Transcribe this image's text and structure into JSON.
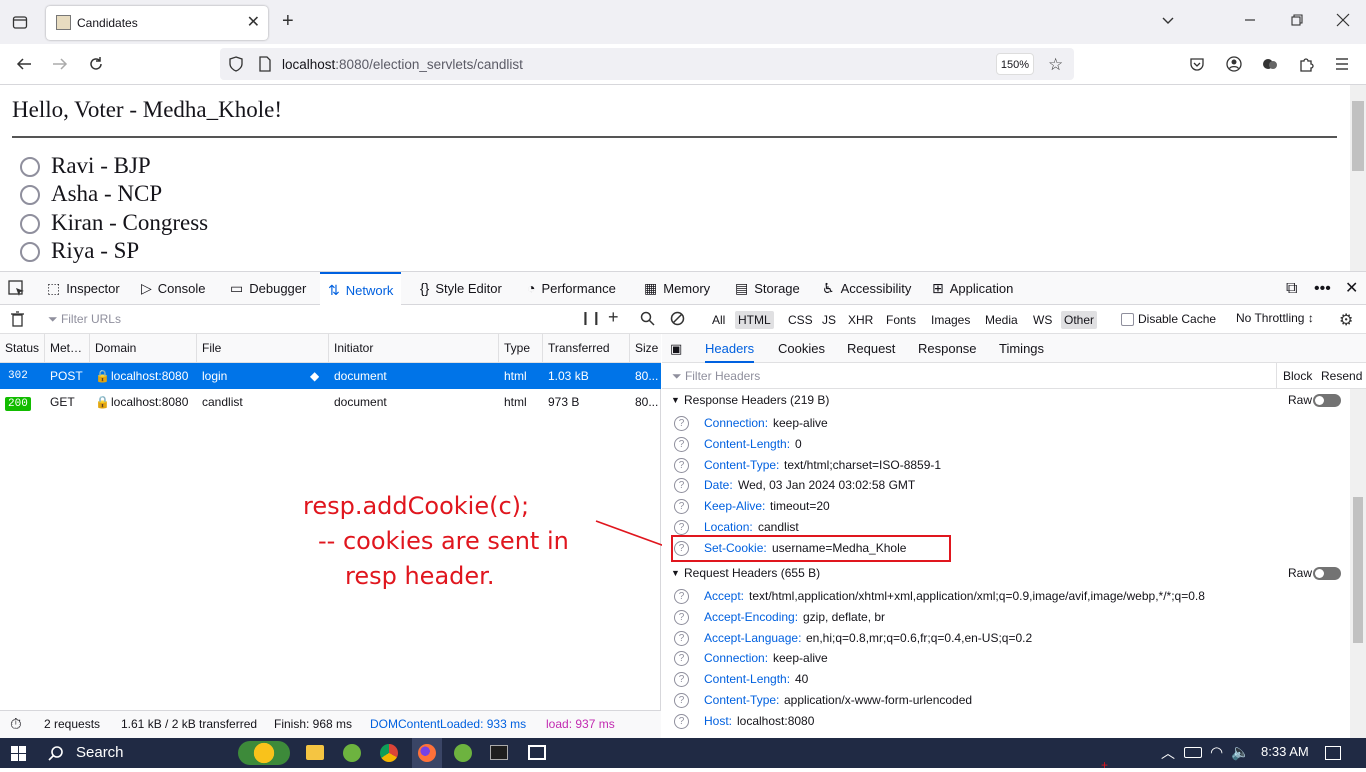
{
  "browser": {
    "tab_title": "Candidates",
    "url_host": "localhost",
    "url_rest": ":8080/election_servlets/candlist",
    "zoom": "150%"
  },
  "page": {
    "greeting": "Hello, Voter - Medha_Khole!",
    "candidates": [
      "Ravi - BJP",
      "Asha - NCP",
      "Kiran - Congress",
      "Riya - SP"
    ]
  },
  "devtools": {
    "tools": [
      "Inspector",
      "Console",
      "Debugger",
      "Network",
      "Style Editor",
      "Performance",
      "Memory",
      "Storage",
      "Accessibility",
      "Application"
    ],
    "filter_placeholder": "Filter URLs",
    "types": [
      "All",
      "HTML",
      "CSS",
      "JS",
      "XHR",
      "Fonts",
      "Images",
      "Media",
      "WS",
      "Other"
    ],
    "disable_cache": "Disable Cache",
    "throttling": "No Throttling ↕",
    "columns": [
      "Status",
      "Met…",
      "Domain",
      "File",
      "Initiator",
      "Type",
      "Transferred",
      "Size"
    ],
    "requests": [
      {
        "status": "302",
        "method": "POST",
        "domain": "localhost:8080",
        "file": "login",
        "initiator": "document",
        "type": "html",
        "transferred": "1.03 kB",
        "size": "80..."
      },
      {
        "status": "200",
        "method": "GET",
        "domain": "localhost:8080",
        "file": "candlist",
        "initiator": "document",
        "type": "html",
        "transferred": "973 B",
        "size": "80..."
      }
    ],
    "statusbar": {
      "requests": "2 requests",
      "transferred": "1.61 kB / 2 kB transferred",
      "finish": "Finish: 968 ms",
      "dcl": "DOMContentLoaded: 933 ms",
      "load": "load: 937 ms"
    },
    "detail_tabs": [
      "Headers",
      "Cookies",
      "Request",
      "Response",
      "Timings"
    ],
    "filter_headers": "Filter Headers",
    "block": "Block",
    "resend": "Resend",
    "raw": "Raw",
    "response_section": "Response Headers (219 B)",
    "response_headers": [
      {
        "k": "Connection:",
        "v": "keep-alive"
      },
      {
        "k": "Content-Length:",
        "v": "0"
      },
      {
        "k": "Content-Type:",
        "v": "text/html;charset=ISO-8859-1"
      },
      {
        "k": "Date:",
        "v": "Wed, 03 Jan 2024 03:02:58 GMT"
      },
      {
        "k": "Keep-Alive:",
        "v": "timeout=20"
      },
      {
        "k": "Location:",
        "v": "candlist"
      },
      {
        "k": "Set-Cookie:",
        "v": "username=Medha_Khole"
      }
    ],
    "request_section": "Request Headers (655 B)",
    "request_headers": [
      {
        "k": "Accept:",
        "v": "text/html,application/xhtml+xml,application/xml;q=0.9,image/avif,image/webp,*/*;q=0.8"
      },
      {
        "k": "Accept-Encoding:",
        "v": "gzip, deflate, br"
      },
      {
        "k": "Accept-Language:",
        "v": "en,hi;q=0.8,mr;q=0.6,fr;q=0.4,en-US;q=0.2"
      },
      {
        "k": "Connection:",
        "v": "keep-alive"
      },
      {
        "k": "Content-Length:",
        "v": "40"
      },
      {
        "k": "Content-Type:",
        "v": "application/x-www-form-urlencoded"
      },
      {
        "k": "Host:",
        "v": "localhost:8080"
      }
    ]
  },
  "annotation": {
    "line1": "resp.addCookie(c);",
    "line2": "-- cookies are sent in",
    "line3": "resp header.",
    "color": "#e0161e"
  },
  "taskbar": {
    "search": "Search",
    "time": "8:33 AM"
  }
}
